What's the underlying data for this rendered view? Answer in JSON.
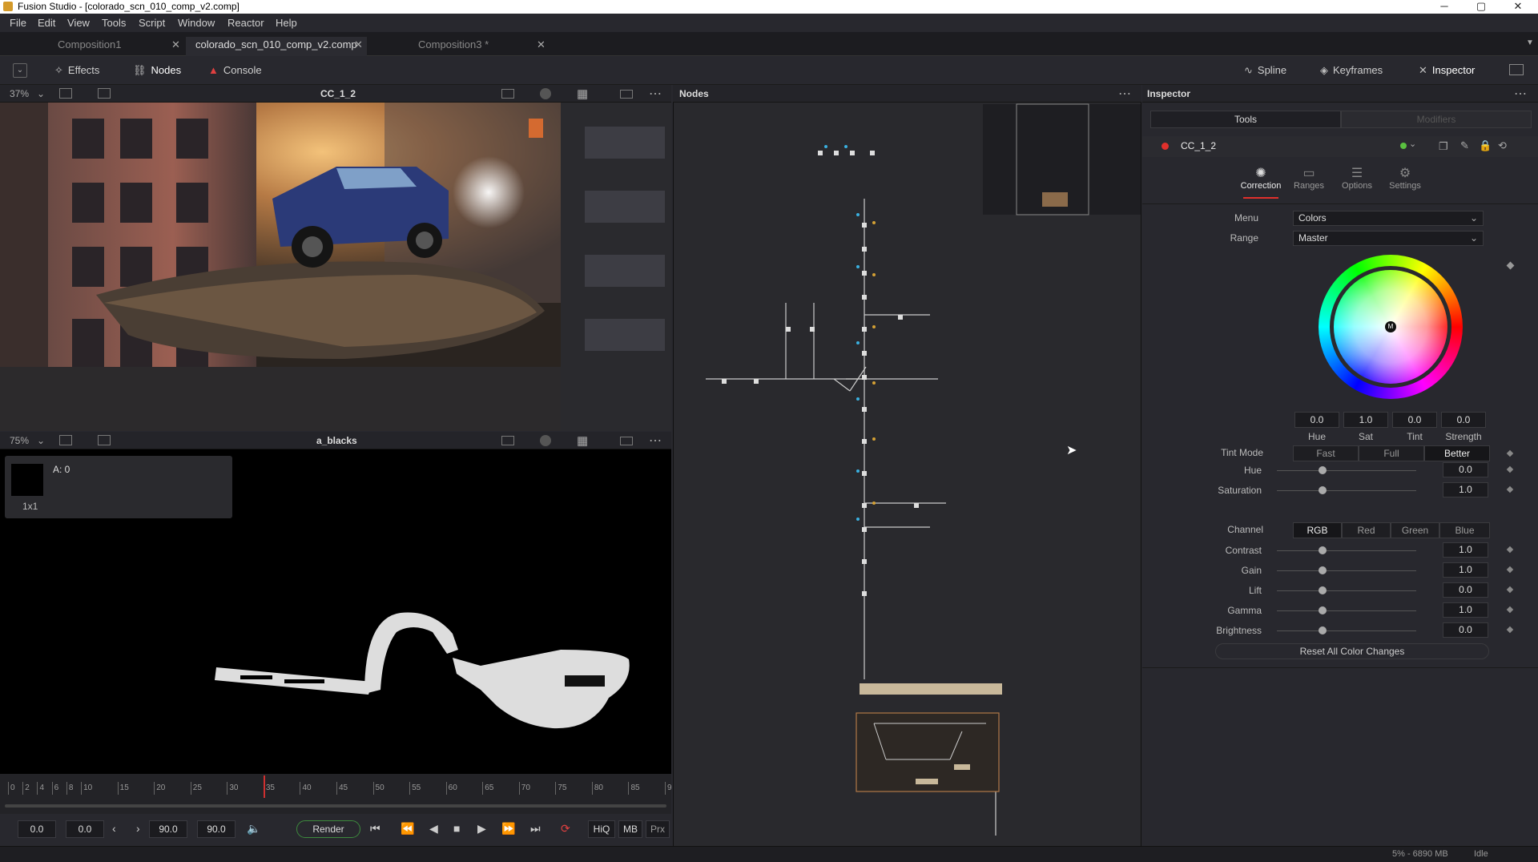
{
  "window": {
    "title": "Fusion Studio - [colorado_scn_010_comp_v2.comp]",
    "minimize": "─",
    "maximize": "▢",
    "close": "✕"
  },
  "menu": [
    "File",
    "Edit",
    "View",
    "Tools",
    "Script",
    "Window",
    "Reactor",
    "Help"
  ],
  "comp_tabs": [
    {
      "label": "Composition1",
      "close": "✕"
    },
    {
      "label": "colorado_scn_010_comp_v2.comp",
      "close": "✕"
    },
    {
      "label": "Composition3 *",
      "close": "✕"
    }
  ],
  "toolbar": {
    "effects": "Effects",
    "nodes": "Nodes",
    "console": "Console",
    "spline": "Spline",
    "keyframes": "Keyframes",
    "inspector": "Inspector"
  },
  "viewer1": {
    "zoom": "37%",
    "title": "CC_1_2"
  },
  "viewer2": {
    "zoom": "75%",
    "title": "a_blacks",
    "info_alpha": "A: 0",
    "info_size": "1x1"
  },
  "timeline": {
    "ticks": [
      "0",
      "2",
      "4",
      "6",
      "8",
      "10",
      "15",
      "20",
      "25",
      "30",
      "35",
      "40",
      "45",
      "50",
      "55",
      "60",
      "65",
      "70",
      "75",
      "80",
      "85",
      "9"
    ],
    "current_frame": 35
  },
  "transport": {
    "start": "0.0",
    "current": "0.0",
    "end1": "90.0",
    "end2": "90.0",
    "render": "Render",
    "hiq": "HiQ",
    "mb": "MB",
    "prx": "Prx"
  },
  "nodes_panel": {
    "title": "Nodes"
  },
  "inspector": {
    "title": "Inspector",
    "tab_tools": "Tools",
    "tab_modifiers": "Modifiers",
    "tool_name": "CC_1_2",
    "subtabs": [
      "Correction",
      "Ranges",
      "Options",
      "Settings"
    ],
    "menu_label": "Menu",
    "menu_value": "Colors",
    "range_label": "Range",
    "range_value": "Master",
    "wheel_marker": "M",
    "wheel_values": [
      {
        "label": "Hue",
        "value": "0.0"
      },
      {
        "label": "Sat",
        "value": "1.0"
      },
      {
        "label": "Tint",
        "value": "0.0"
      },
      {
        "label": "Strength",
        "value": "0.0"
      }
    ],
    "tint_mode_label": "Tint Mode",
    "tint_modes": [
      "Fast",
      "Full",
      "Better"
    ],
    "hue": {
      "label": "Hue",
      "value": "0.0"
    },
    "saturation": {
      "label": "Saturation",
      "value": "1.0"
    },
    "channel_label": "Channel",
    "channels": [
      "RGB",
      "Red",
      "Green",
      "Blue"
    ],
    "sliders": [
      {
        "label": "Contrast",
        "value": "1.0"
      },
      {
        "label": "Gain",
        "value": "1.0"
      },
      {
        "label": "Lift",
        "value": "0.0"
      },
      {
        "label": "Gamma",
        "value": "1.0"
      },
      {
        "label": "Brightness",
        "value": "0.0"
      }
    ],
    "reset": "Reset All Color Changes"
  },
  "status": {
    "memory": "5% - 6890 MB",
    "state": "Idle"
  }
}
